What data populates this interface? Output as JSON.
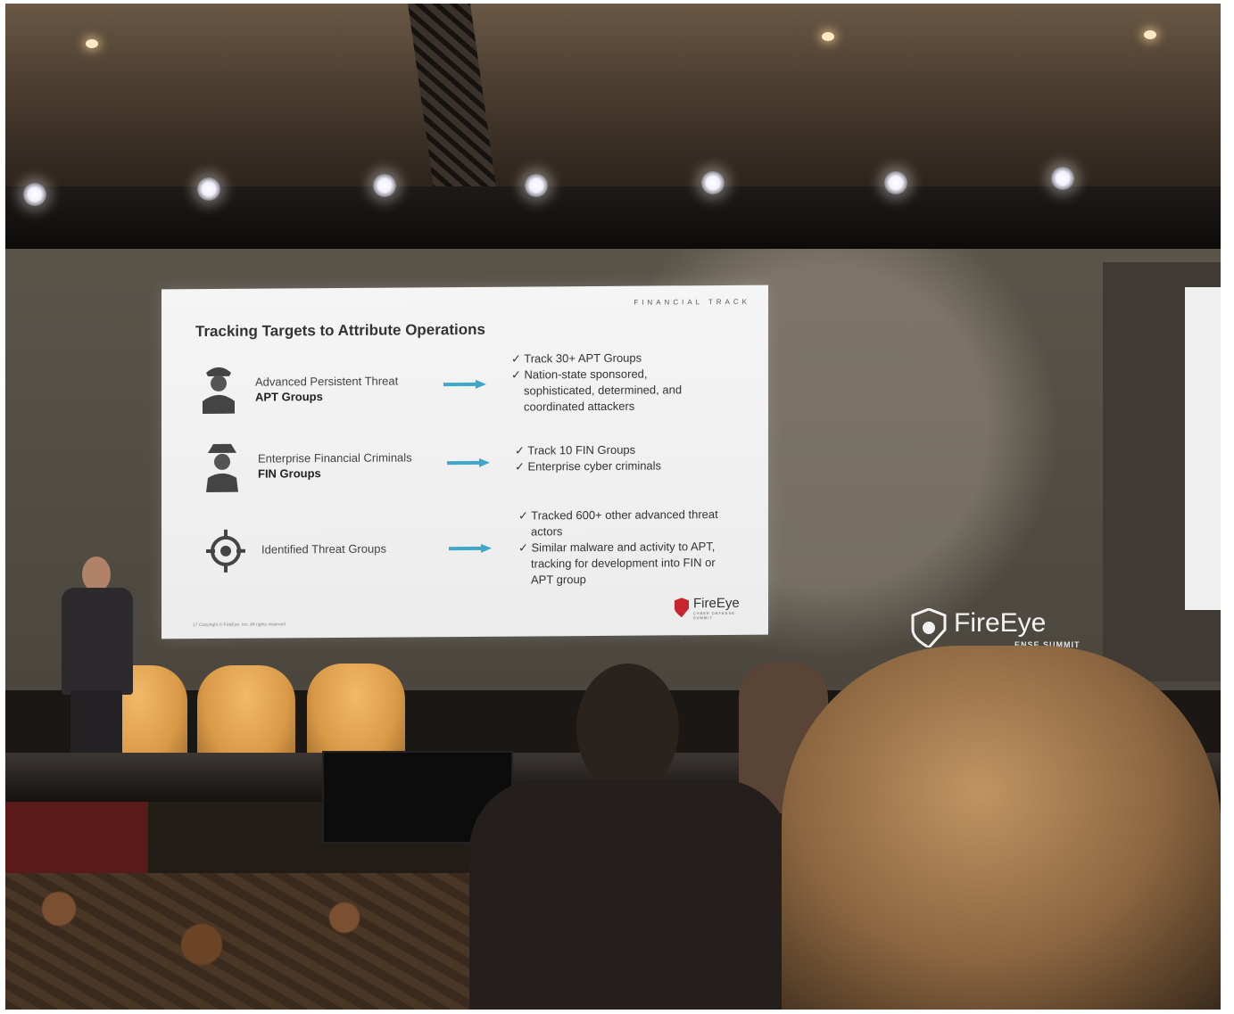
{
  "slide": {
    "track_label": "FINANCIAL TRACK",
    "title": "Tracking Targets to Attribute Operations",
    "rows": [
      {
        "icon": "officer-icon",
        "label_line1": "Advanced Persistent Threat",
        "label_line2": "APT Groups",
        "bullets": [
          "✓ Track 30+ APT Groups",
          "✓ Nation-state sponsored, sophisticated, determined, and coordinated attackers"
        ]
      },
      {
        "icon": "spy-icon",
        "label_line1": "Enterprise Financial Criminals",
        "label_line2": "FIN Groups",
        "bullets": [
          "✓ Track 10 FIN Groups",
          "✓ Enterprise cyber criminals"
        ]
      },
      {
        "icon": "crosshair-icon",
        "label_line1": "Identified Threat Groups",
        "label_line2": "",
        "bullets": [
          "✓ Tracked 600+ other advanced threat actors",
          "✓ Similar malware and activity to APT, tracking for development into FIN or APT group"
        ]
      }
    ],
    "footer": "17    Copyright © FireEye, Inc. All rights reserved.",
    "logo_name": "FireEye",
    "logo_sub": "CYBER DEFENSE SUMMIT"
  },
  "backdrop": {
    "brand_name": "FireEye",
    "brand_tag": "ENSE SUMMIT"
  },
  "colors": {
    "arrow": "#3fa7c9",
    "slide_bg": "#f2f2f2",
    "chair": "#e0a04f",
    "logo_red": "#c8262f"
  }
}
